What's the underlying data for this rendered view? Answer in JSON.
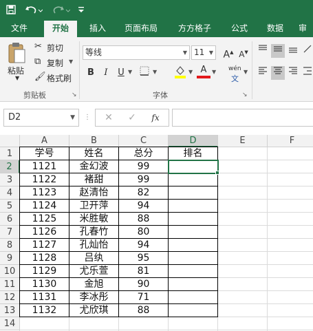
{
  "quick_access": {
    "save_icon": "save-icon",
    "undo_icon": "undo-icon",
    "redo_icon": "redo-icon",
    "customize_icon": "customize-icon"
  },
  "tabs": [
    {
      "label": "文件",
      "active": false
    },
    {
      "label": "开始",
      "active": true
    },
    {
      "label": "插入",
      "active": false
    },
    {
      "label": "页面布局",
      "active": false
    },
    {
      "label": "方方格子",
      "active": false
    },
    {
      "label": "公式",
      "active": false
    },
    {
      "label": "数据",
      "active": false
    },
    {
      "label": "审",
      "active": false
    }
  ],
  "ribbon": {
    "clipboard": {
      "paste_label": "粘贴",
      "cut_label": "剪切",
      "copy_label": "复制",
      "format_painter_label": "格式刷",
      "group_label": "剪贴板"
    },
    "font": {
      "font_name": "等线",
      "font_size": "11",
      "increase_label": "A",
      "decrease_label": "A",
      "bold_label": "B",
      "italic_label": "I",
      "underline_label": "U",
      "font_color_label": "A",
      "phonetic_label": "wén",
      "group_label": "字体"
    }
  },
  "formula_bar": {
    "name_box": "D2",
    "cancel_symbol": "✕",
    "enter_symbol": "✓",
    "fx_label": "fx",
    "content": ""
  },
  "sheet": {
    "columns": [
      "A",
      "B",
      "C",
      "D",
      "E",
      "F"
    ],
    "row_numbers": [
      "1",
      "2",
      "3",
      "4",
      "5",
      "6",
      "7",
      "8",
      "9",
      "10",
      "11",
      "12",
      "13",
      "14"
    ],
    "selected_column": "D",
    "selected_row": "2",
    "rows": [
      [
        "学号",
        "姓名",
        "总分",
        "排名"
      ],
      [
        "1121",
        "金幻波",
        "99",
        ""
      ],
      [
        "1122",
        "褚甜",
        "99",
        ""
      ],
      [
        "1123",
        "赵清怡",
        "82",
        ""
      ],
      [
        "1124",
        "卫开萍",
        "94",
        ""
      ],
      [
        "1125",
        "米胜敏",
        "88",
        ""
      ],
      [
        "1126",
        "孔春竹",
        "80",
        ""
      ],
      [
        "1127",
        "孔灿怡",
        "94",
        ""
      ],
      [
        "1128",
        "吕纨",
        "95",
        ""
      ],
      [
        "1129",
        "尤乐萱",
        "81",
        ""
      ],
      [
        "1130",
        "金旭",
        "90",
        ""
      ],
      [
        "1131",
        "李冰彤",
        "71",
        ""
      ],
      [
        "1132",
        "尤欣琪",
        "88",
        ""
      ]
    ]
  },
  "colors": {
    "accent": "#217346",
    "ribbon_bg": "#f3f3f3",
    "header_bg": "#f2f2f2",
    "selected_header_bg": "#d3d3d3"
  }
}
